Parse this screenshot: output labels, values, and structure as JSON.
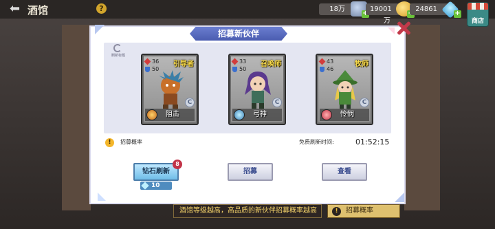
{
  "header": {
    "title": "酒馆",
    "resources": [
      {
        "value": "18万",
        "icon": "iron-icon"
      },
      {
        "value": "19001万",
        "icon": "gold-coin-icon"
      },
      {
        "value": "24861",
        "icon": "diamond-icon"
      }
    ],
    "shop_label": "商店"
  },
  "modal": {
    "title": "招募新伙伴",
    "refresh_hint": "刷新标题",
    "heroes": [
      {
        "class": "引导者",
        "atk": "36",
        "def": "50",
        "skill": "阻击",
        "grade": "C",
        "color": "#c8702a"
      },
      {
        "class": "召唤师",
        "atk": "33",
        "def": "50",
        "skill": "弓神",
        "grade": "C",
        "color": "#6a4a9e"
      },
      {
        "class": "牧师",
        "atk": "43",
        "def": "46",
        "skill": "怜悯",
        "grade": "C",
        "color": "#4a8a3a"
      }
    ],
    "rate_label": "招募概率",
    "free_refresh_label": "免费刷新时间:",
    "timer": "01:52:15",
    "buttons": {
      "diamond_refresh": "钻石刷新",
      "recruit": "招募",
      "view": "查看"
    },
    "badge_count": "8",
    "cost": "10"
  },
  "footer": {
    "tip": "酒馆等级越高，高品质的新伙伴招募概率越高",
    "rate_button": "招募概率"
  },
  "colors": {
    "accent": "#4a5cb0",
    "gold": "#f6d94a",
    "badge": "#c23348"
  }
}
